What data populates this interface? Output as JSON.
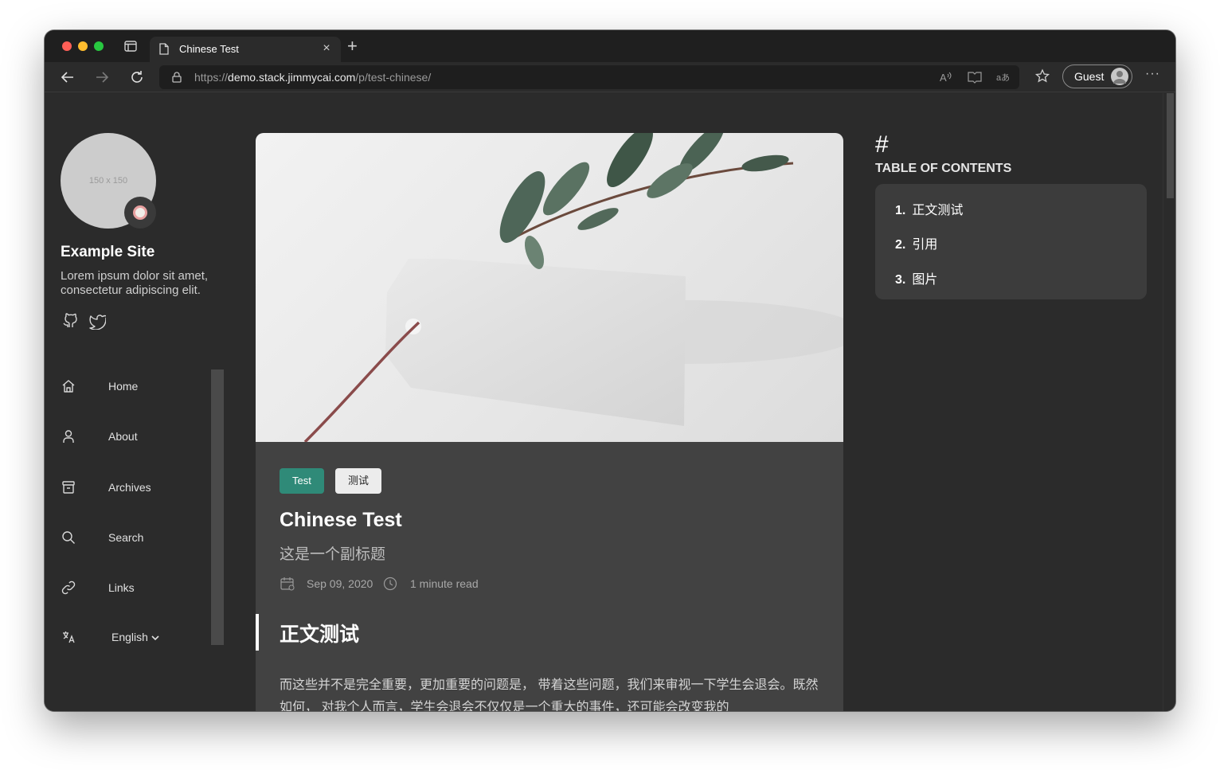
{
  "browser": {
    "tab_title": "Chinese Test",
    "tab_close": "×",
    "new_tab": "+",
    "url_scheme": "https://",
    "url_host": "demo.stack.jimmycai.com",
    "url_path": "/p/test-chinese/",
    "profile_label": "Guest",
    "more": "···"
  },
  "sidebar": {
    "avatar_placeholder": "150 x 150",
    "site_title": "Example Site",
    "site_description": "Lorem ipsum dolor sit amet, consectetur adipiscing elit.",
    "social": [
      "github-icon",
      "twitter-icon"
    ],
    "menu": [
      {
        "label": "Home",
        "icon": "home-icon"
      },
      {
        "label": "About",
        "icon": "user-icon"
      },
      {
        "label": "Archives",
        "icon": "archive-icon"
      },
      {
        "label": "Search",
        "icon": "search-icon"
      },
      {
        "label": "Links",
        "icon": "link-icon"
      }
    ],
    "language": "English"
  },
  "article": {
    "tags": [
      "Test",
      "测试"
    ],
    "title": "Chinese Test",
    "subtitle": "这是一个副标题",
    "date": "Sep 09, 2020",
    "read_time": "1 minute read",
    "heading": "正文测试",
    "paragraph": "而这些并不是完全重要，更加重要的问题是， 带着这些问题，我们来审视一下学生会退会。既然如何， 对我个人而言，学生会退会不仅仅是一个重大的事件，还可能会改变我的"
  },
  "toc": {
    "hash": "#",
    "title": "TABLE OF CONTENTS",
    "items": [
      {
        "num": "1.",
        "label": "正文测试"
      },
      {
        "num": "2.",
        "label": "引用"
      },
      {
        "num": "3.",
        "label": "图片"
      }
    ]
  },
  "colors": {
    "page_bg": "#2b2b2b",
    "card_bg": "#424242",
    "tag_accent": "#2f8a78"
  }
}
